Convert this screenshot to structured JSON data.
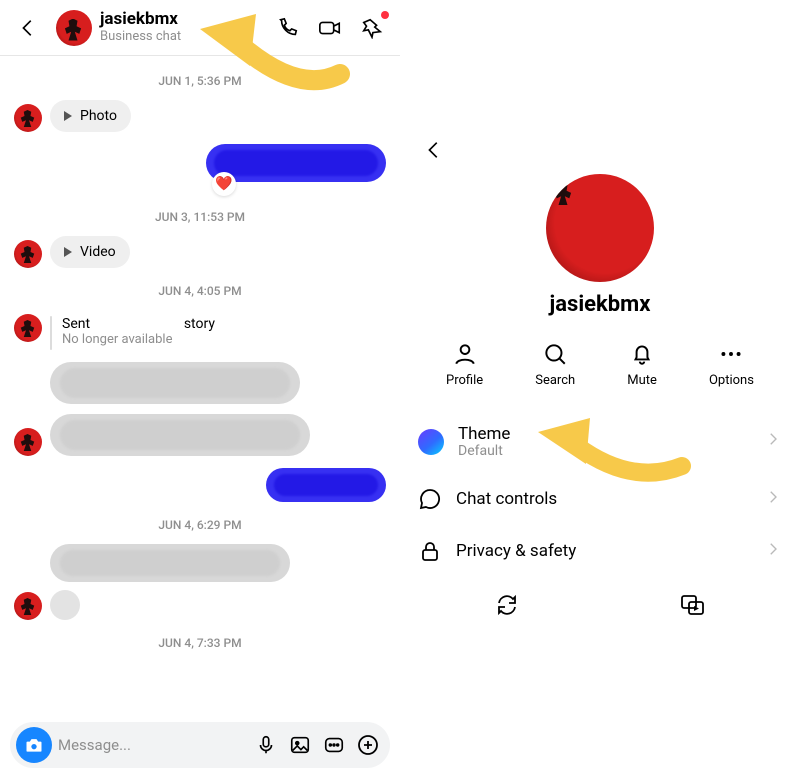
{
  "header": {
    "username": "jasiekbmx",
    "subtitle": "Business chat"
  },
  "timestamps": {
    "t1": "JUN 1, 5:36 PM",
    "t2": "JUN 3, 11:53 PM",
    "t3": "JUN 4, 4:05 PM",
    "t4": "JUN 4, 6:29 PM",
    "t5": "JUN 4, 7:33 PM"
  },
  "bubbles": {
    "photo": "Photo",
    "video": "Video"
  },
  "sent_story": {
    "line1_a": "Sent",
    "line1_b": "story",
    "line2": "No longer available"
  },
  "reaction": {
    "heart": "❤️"
  },
  "composer": {
    "placeholder": "Message..."
  },
  "details": {
    "name": "jasiekbmx",
    "actions": {
      "profile": "Profile",
      "search": "Search",
      "mute": "Mute",
      "options": "Options"
    },
    "options": {
      "theme_label": "Theme",
      "theme_value": "Default",
      "chat_controls": "Chat controls",
      "privacy": "Privacy & safety"
    }
  }
}
